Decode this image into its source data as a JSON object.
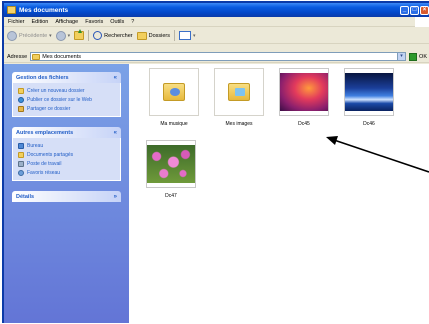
{
  "window": {
    "title": "Mes documents"
  },
  "menu": [
    "Fichier",
    "Edition",
    "Affichage",
    "Favoris",
    "Outils",
    "?"
  ],
  "toolbar": {
    "back_label": "Précédente",
    "search_label": "Rechercher",
    "folders_label": "Dossiers"
  },
  "address": {
    "label": "Adresse",
    "value": "Mes documents",
    "go_label": "OK"
  },
  "taskpane": {
    "file_tasks": {
      "title": "Gestion des fichiers",
      "items": [
        "Créer un nouveau dossier",
        "Publier ce dossier sur le Web",
        "Partager ce dossier"
      ]
    },
    "other_places": {
      "title": "Autres emplacements",
      "items": [
        "Bureau",
        "Documents partagés",
        "Poste de travail",
        "Favoris réseau"
      ]
    },
    "details": {
      "title": "Détails"
    }
  },
  "files": [
    {
      "name": "Ma musique",
      "kind": "folder-music"
    },
    {
      "name": "Mes images",
      "kind": "folder-pictures"
    },
    {
      "name": "Dc45",
      "kind": "photo-sunset"
    },
    {
      "name": "Dc46",
      "kind": "photo-waves"
    },
    {
      "name": "Dc47",
      "kind": "photo-flowers"
    }
  ],
  "colors": {
    "title_bar": "#0347c8",
    "task_pane": "#7ba2e7",
    "link": "#215dc6"
  }
}
